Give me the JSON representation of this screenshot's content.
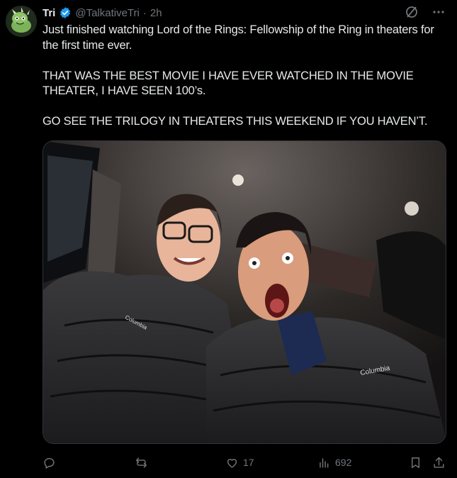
{
  "user": {
    "name": "Tri",
    "handle": "@TalkativeTri",
    "separator": "·",
    "time": "2h"
  },
  "tweet": {
    "line1": "Just finished watching Lord of the Rings: Fellowship of the Ring in theaters for the first time ever.",
    "line2": "THAT WAS THE BEST MOVIE I HAVE EVER WATCHED IN THE MOVIE THEATER, I HAVE SEEN 100’s.",
    "line3": "GO SEE THE TRILOGY IN THEATERS THIS WEEKEND IF YOU HAVEN’T."
  },
  "photo": {
    "jacket_brand_left": "Columbia",
    "jacket_brand_right": "Columbia"
  },
  "actions": {
    "replies": "",
    "reposts": "",
    "likes": "17",
    "views": "692"
  },
  "colors": {
    "background": "#000000",
    "text": "#e7e9ea",
    "muted": "#71767b",
    "verified": "#1d9bf0"
  },
  "icons": [
    "avatar-dino-icon",
    "verified-badge-icon",
    "grok-icon",
    "more-icon",
    "reply-icon",
    "repost-icon",
    "like-icon",
    "views-icon",
    "bookmark-icon",
    "share-icon"
  ]
}
